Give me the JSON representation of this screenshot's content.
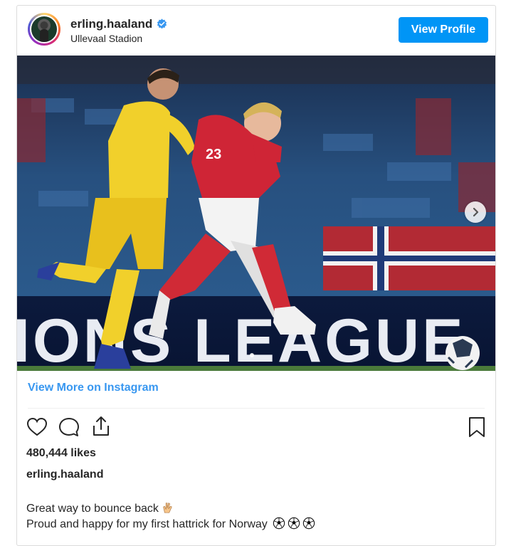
{
  "post": {
    "username": "erling.haaland",
    "location": "Ullevaal Stadion",
    "verified": true,
    "view_profile_label": "View Profile",
    "view_more_label": "View More on Instagram",
    "likes": "480,444 likes",
    "caption_user": "erling.haaland",
    "caption_line1": "Great way to bounce back",
    "caption_line2": "Proud and happy for my first hattrick for Norway",
    "photo_banner_text": "IONS LEAGUE"
  },
  "icons": {
    "verified": "verified-badge-icon",
    "like": "heart-icon",
    "comment": "comment-icon",
    "share": "share-icon",
    "save": "bookmark-icon",
    "next": "chevron-right-icon",
    "caption_emoji_1": "hand-emoji",
    "caption_emoji_2": "soccer-ball-emoji"
  },
  "colors": {
    "accent": "#0095f6",
    "link": "#3897f0",
    "text": "#262626",
    "border": "#dbdbdb"
  }
}
